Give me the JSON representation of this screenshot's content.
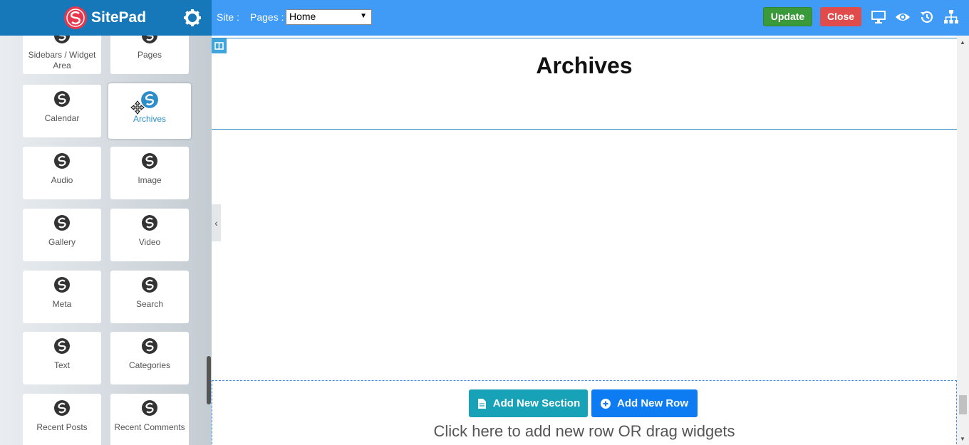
{
  "app": {
    "brand": "SitePad"
  },
  "topbar": {
    "site_label": "Site :",
    "pages_label": "Pages :",
    "pages_selected": "Home",
    "update_label": "Update",
    "close_label": "Close",
    "icons": [
      "desktop-icon",
      "eye-icon",
      "history-icon",
      "sitemap-icon"
    ]
  },
  "widgets": [
    {
      "label": "Sidebars / Widget Area"
    },
    {
      "label": "Pages"
    },
    {
      "label": "Calendar"
    },
    {
      "label": "Archives",
      "state": "dragging"
    },
    {
      "label": "Audio"
    },
    {
      "label": "Image"
    },
    {
      "label": "Gallery"
    },
    {
      "label": "Video"
    },
    {
      "label": "Meta"
    },
    {
      "label": "Search"
    },
    {
      "label": "Text"
    },
    {
      "label": "Categories"
    },
    {
      "label": "Recent Posts"
    },
    {
      "label": "Recent Comments"
    }
  ],
  "canvas": {
    "heading": "Archives",
    "add_section_label": "Add New Section",
    "add_row_label": "Add New Row",
    "drop_hint": "Click here to add new row OR drag widgets"
  },
  "colors": {
    "sidebar_header": "#1678b8",
    "topbar": "#3f9bf5",
    "update": "#3a9a3a",
    "close": "#e04b4b",
    "add_section": "#17a2b8",
    "add_row": "#0d7cf2",
    "accent": "#2c8dc9"
  }
}
